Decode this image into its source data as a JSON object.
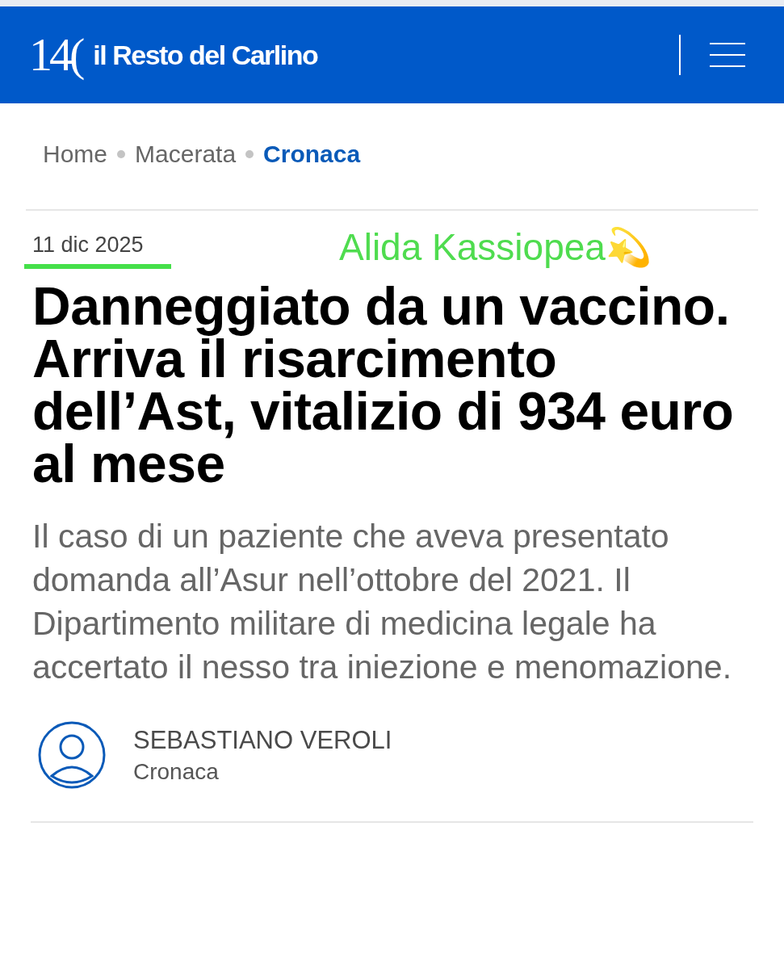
{
  "header": {
    "logo_number": "14(",
    "logo_name": "il Resto del Carlino"
  },
  "breadcrumb": [
    {
      "label": "Home",
      "selected": false
    },
    {
      "label": "Macerata",
      "selected": false
    },
    {
      "label": "Cronaca",
      "selected": true
    }
  ],
  "date": "11 dic 2025",
  "annotation": "Alida Kassiopea💫",
  "headline": "Danneggiato da un vaccino. Arriva il risarcimento dell’Ast, vitalizio di 934 euro al mese",
  "summary": "Il caso di un paziente che aveva presentato domanda all’Asur nell’ottobre del 2021. Il Dipartimento militare di medicina legale ha accertato il nesso tra iniezione e menomazione.",
  "author": {
    "name": "SEBASTIANO VEROLI",
    "section": "Cronaca"
  }
}
